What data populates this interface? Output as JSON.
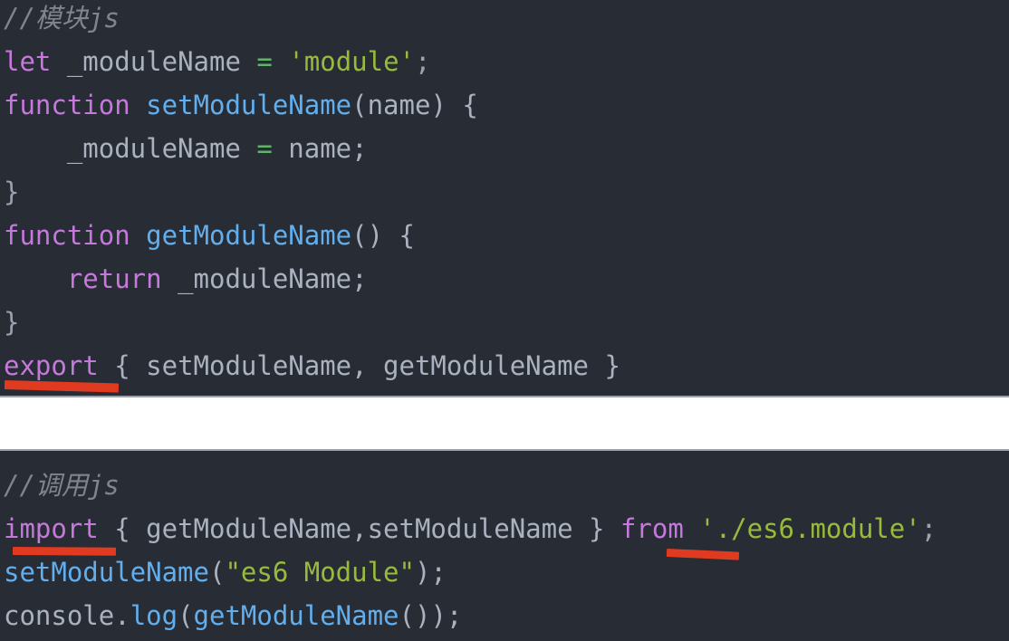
{
  "editor": {
    "theme_name": "one-dark",
    "background_color": "#282c35",
    "separator_color": "#ffffff",
    "default_text_color": "#abb2bf",
    "comment_color": "#7f848e",
    "keyword_color": "#c678dd",
    "function_color": "#61afef",
    "string_color": "#98bb3c",
    "operator_color": "#5fb36a",
    "annotation_color": "#e03a20"
  },
  "panels": [
    {
      "id": "module-file",
      "lines": [
        {
          "id": "m1",
          "tokens": [
            {
              "text": "//模块js",
              "type": "comment"
            }
          ]
        },
        {
          "id": "m2",
          "tokens": [
            {
              "text": "let",
              "type": "keyword"
            },
            {
              "text": " _moduleName ",
              "type": "plain"
            },
            {
              "text": "=",
              "type": "operator"
            },
            {
              "text": " ",
              "type": "plain"
            },
            {
              "text": "'module'",
              "type": "string"
            },
            {
              "text": ";",
              "type": "punct"
            }
          ]
        },
        {
          "id": "m3",
          "tokens": [
            {
              "text": "function",
              "type": "keyword"
            },
            {
              "text": " ",
              "type": "plain"
            },
            {
              "text": "setModuleName",
              "type": "func"
            },
            {
              "text": "(name) {",
              "type": "plain"
            }
          ]
        },
        {
          "id": "m4",
          "tokens": [
            {
              "text": "    _moduleName ",
              "type": "plain"
            },
            {
              "text": "=",
              "type": "operator"
            },
            {
              "text": " name;",
              "type": "plain"
            }
          ]
        },
        {
          "id": "m5",
          "tokens": [
            {
              "text": "}",
              "type": "punct"
            }
          ]
        },
        {
          "id": "m6",
          "tokens": [
            {
              "text": "function",
              "type": "keyword"
            },
            {
              "text": " ",
              "type": "plain"
            },
            {
              "text": "getModuleName",
              "type": "func"
            },
            {
              "text": "() {",
              "type": "plain"
            }
          ]
        },
        {
          "id": "m7",
          "tokens": [
            {
              "text": "    ",
              "type": "plain"
            },
            {
              "text": "return",
              "type": "keyword"
            },
            {
              "text": " _moduleName;",
              "type": "plain"
            }
          ]
        },
        {
          "id": "m8",
          "tokens": [
            {
              "text": "}",
              "type": "punct"
            }
          ]
        },
        {
          "id": "m9",
          "tokens": [
            {
              "text": "export",
              "type": "keyword"
            },
            {
              "text": " { setModuleName, getModuleName }",
              "type": "plain"
            }
          ]
        }
      ]
    },
    {
      "id": "caller-file",
      "lines": [
        {
          "id": "c1",
          "tokens": [
            {
              "text": "//调用js",
              "type": "comment"
            }
          ]
        },
        {
          "id": "c2",
          "tokens": [
            {
              "text": "import",
              "type": "keyword"
            },
            {
              "text": " { getModuleName,setModuleName } ",
              "type": "plain"
            },
            {
              "text": "from",
              "type": "keyword"
            },
            {
              "text": " ",
              "type": "plain"
            },
            {
              "text": "'./es6.module'",
              "type": "string"
            },
            {
              "text": ";",
              "type": "punct"
            }
          ]
        },
        {
          "id": "c3",
          "tokens": [
            {
              "text": "setModuleName",
              "type": "func"
            },
            {
              "text": "(",
              "type": "plain"
            },
            {
              "text": "\"es6 Module\"",
              "type": "string"
            },
            {
              "text": ");",
              "type": "plain"
            }
          ]
        },
        {
          "id": "c4",
          "tokens": [
            {
              "text": "console",
              "type": "plain"
            },
            {
              "text": ".",
              "type": "plain"
            },
            {
              "text": "log",
              "type": "func"
            },
            {
              "text": "(",
              "type": "plain"
            },
            {
              "text": "getModuleName",
              "type": "func"
            },
            {
              "text": "());",
              "type": "plain"
            }
          ]
        }
      ]
    }
  ],
  "annotations": [
    {
      "id": "underline-export",
      "target_text": "export",
      "color": "#e03a20"
    },
    {
      "id": "underline-import",
      "target_text": "import",
      "color": "#e03a20"
    },
    {
      "id": "underline-from",
      "target_text": "from",
      "color": "#e03a20"
    }
  ]
}
